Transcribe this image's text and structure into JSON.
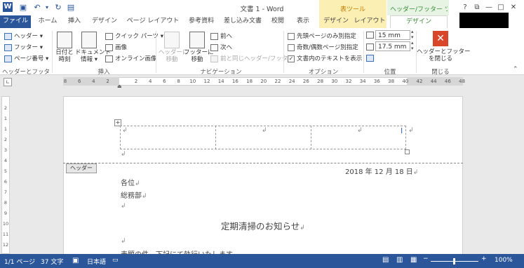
{
  "window": {
    "title": "文書 1 - Word",
    "context_groups": [
      "表ツール",
      "ヘッダー/フッター ツ..."
    ],
    "controls": [
      "?",
      "⧉",
      "—",
      "□",
      "✕"
    ]
  },
  "tabs": [
    "ファイル",
    "ホーム",
    "挿入",
    "デザイン",
    "ページ レイアウト",
    "参考資料",
    "差し込み文書",
    "校閲",
    "表示",
    "デザイン",
    "レイアウト",
    "デザイン"
  ],
  "ribbon": {
    "hf_group": {
      "label": "ヘッダーとフッター",
      "header": "ヘッダー ▾",
      "footer": "フッター ▾",
      "page_number": "ページ番号 ▾"
    },
    "insert_group": {
      "label": "挿入",
      "datetime": [
        "日付と",
        "時刻"
      ],
      "docinfo": [
        "ドキュメント",
        "情報 ▾"
      ],
      "quickparts": "クイック パーツ ▾",
      "picture": "画像",
      "online_picture": "オンライン画像"
    },
    "nav_group": {
      "label": "ナビゲーション",
      "goto_header": [
        "ヘッダーに",
        "移動"
      ],
      "goto_footer": [
        "フッターに",
        "移動"
      ],
      "prev": "前へ",
      "next": "次へ",
      "link_prev": "前と同じヘッダー/フッター"
    },
    "options_group": {
      "label": "オプション",
      "first_page": "先頭ページのみ別指定",
      "odd_even": "奇数/偶数ページ別指定",
      "show_text": "文書内のテキストを表示"
    },
    "position_group": {
      "label": "位置",
      "header_pos": "15 mm",
      "footer_pos": "17.5 mm"
    },
    "close_group": {
      "label": "閉じる",
      "close": [
        "ヘッダーとフッター",
        "を閉じる"
      ]
    }
  },
  "ruler": {
    "ticks": [
      "8",
      "6",
      "4",
      "2",
      "",
      "2",
      "4",
      "6",
      "8",
      "10",
      "12",
      "14",
      "16",
      "18",
      "20",
      "22",
      "24",
      "26",
      "28",
      "30",
      "32",
      "34",
      "36",
      "38",
      "40",
      "42",
      "44",
      "46",
      "48"
    ],
    "vticks": [
      "2",
      "1",
      "1",
      "2",
      "3",
      "4",
      "5",
      "6",
      "7",
      "8",
      "9",
      "10",
      "11",
      "12"
    ]
  },
  "document": {
    "header_label": "ヘッダー",
    "date": "2018 年 12 月 18 日",
    "line1": "各位",
    "line2": "総務部",
    "heading": "定期清掃のお知らせ",
    "cut_line": "表題の件、下記にて執行いたします。"
  },
  "status": {
    "page": "1/1 ページ",
    "words": "37 文字",
    "language": "日本語",
    "zoom": "100%"
  }
}
